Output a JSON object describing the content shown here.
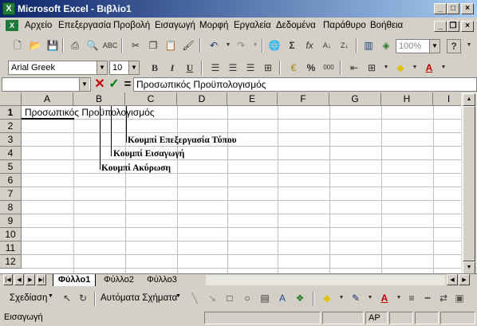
{
  "window": {
    "title": "Microsoft Excel - Βιβλίο1",
    "minimize": "_",
    "maximize": "□",
    "close": "×"
  },
  "menu": {
    "items": [
      "Αρχείο",
      "Επεξεργασία",
      "Προβολή",
      "Εισαγωγή",
      "Μορφή",
      "Εργαλεία",
      "Δεδομένα",
      "Παράθυρο",
      "Βοήθεια"
    ]
  },
  "toolbar_standard": {
    "zoom": "100%",
    "help": "?"
  },
  "toolbar_format": {
    "font": "Arial Greek",
    "size": "10",
    "bold": "B",
    "italic": "I",
    "underline": "U",
    "percent": "%",
    "thousands": "000"
  },
  "formula_bar": {
    "name_box": "",
    "cancel_symbol": "✕",
    "enter_symbol": "✓",
    "edit_symbol": "=",
    "content": "Προσωπικός Προϋπολογισμός"
  },
  "grid": {
    "columns": [
      "A",
      "B",
      "C",
      "D",
      "E",
      "F",
      "G",
      "H",
      "I"
    ],
    "rows": [
      "1",
      "2",
      "3",
      "4",
      "5",
      "6",
      "7",
      "8",
      "9",
      "10",
      "11",
      "12"
    ],
    "cell_A1": "Προσωπικός Προϋπολογισμός"
  },
  "annotations": {
    "edit_formula": "Κουμπί Επεξεργασία Τύπου",
    "enter": "Κουμπί Εισαγωγή",
    "cancel": "Κουμπί Ακύρωση"
  },
  "sheets": {
    "tabs": [
      "Φύλλο1",
      "Φύλλο2",
      "Φύλλο3"
    ],
    "active": "Φύλλο1"
  },
  "drawing_toolbar": {
    "draw": "Σχεδίαση",
    "autoshapes": "Αυτόματα Σχήματα"
  },
  "status": {
    "mode": "Εισαγωγή",
    "caps": "AP"
  },
  "colors": {
    "title_start": "#0a246a",
    "title_end": "#a6caf0",
    "cancel": "#cc0000",
    "enter": "#008000",
    "face": "#d4d0c8"
  }
}
